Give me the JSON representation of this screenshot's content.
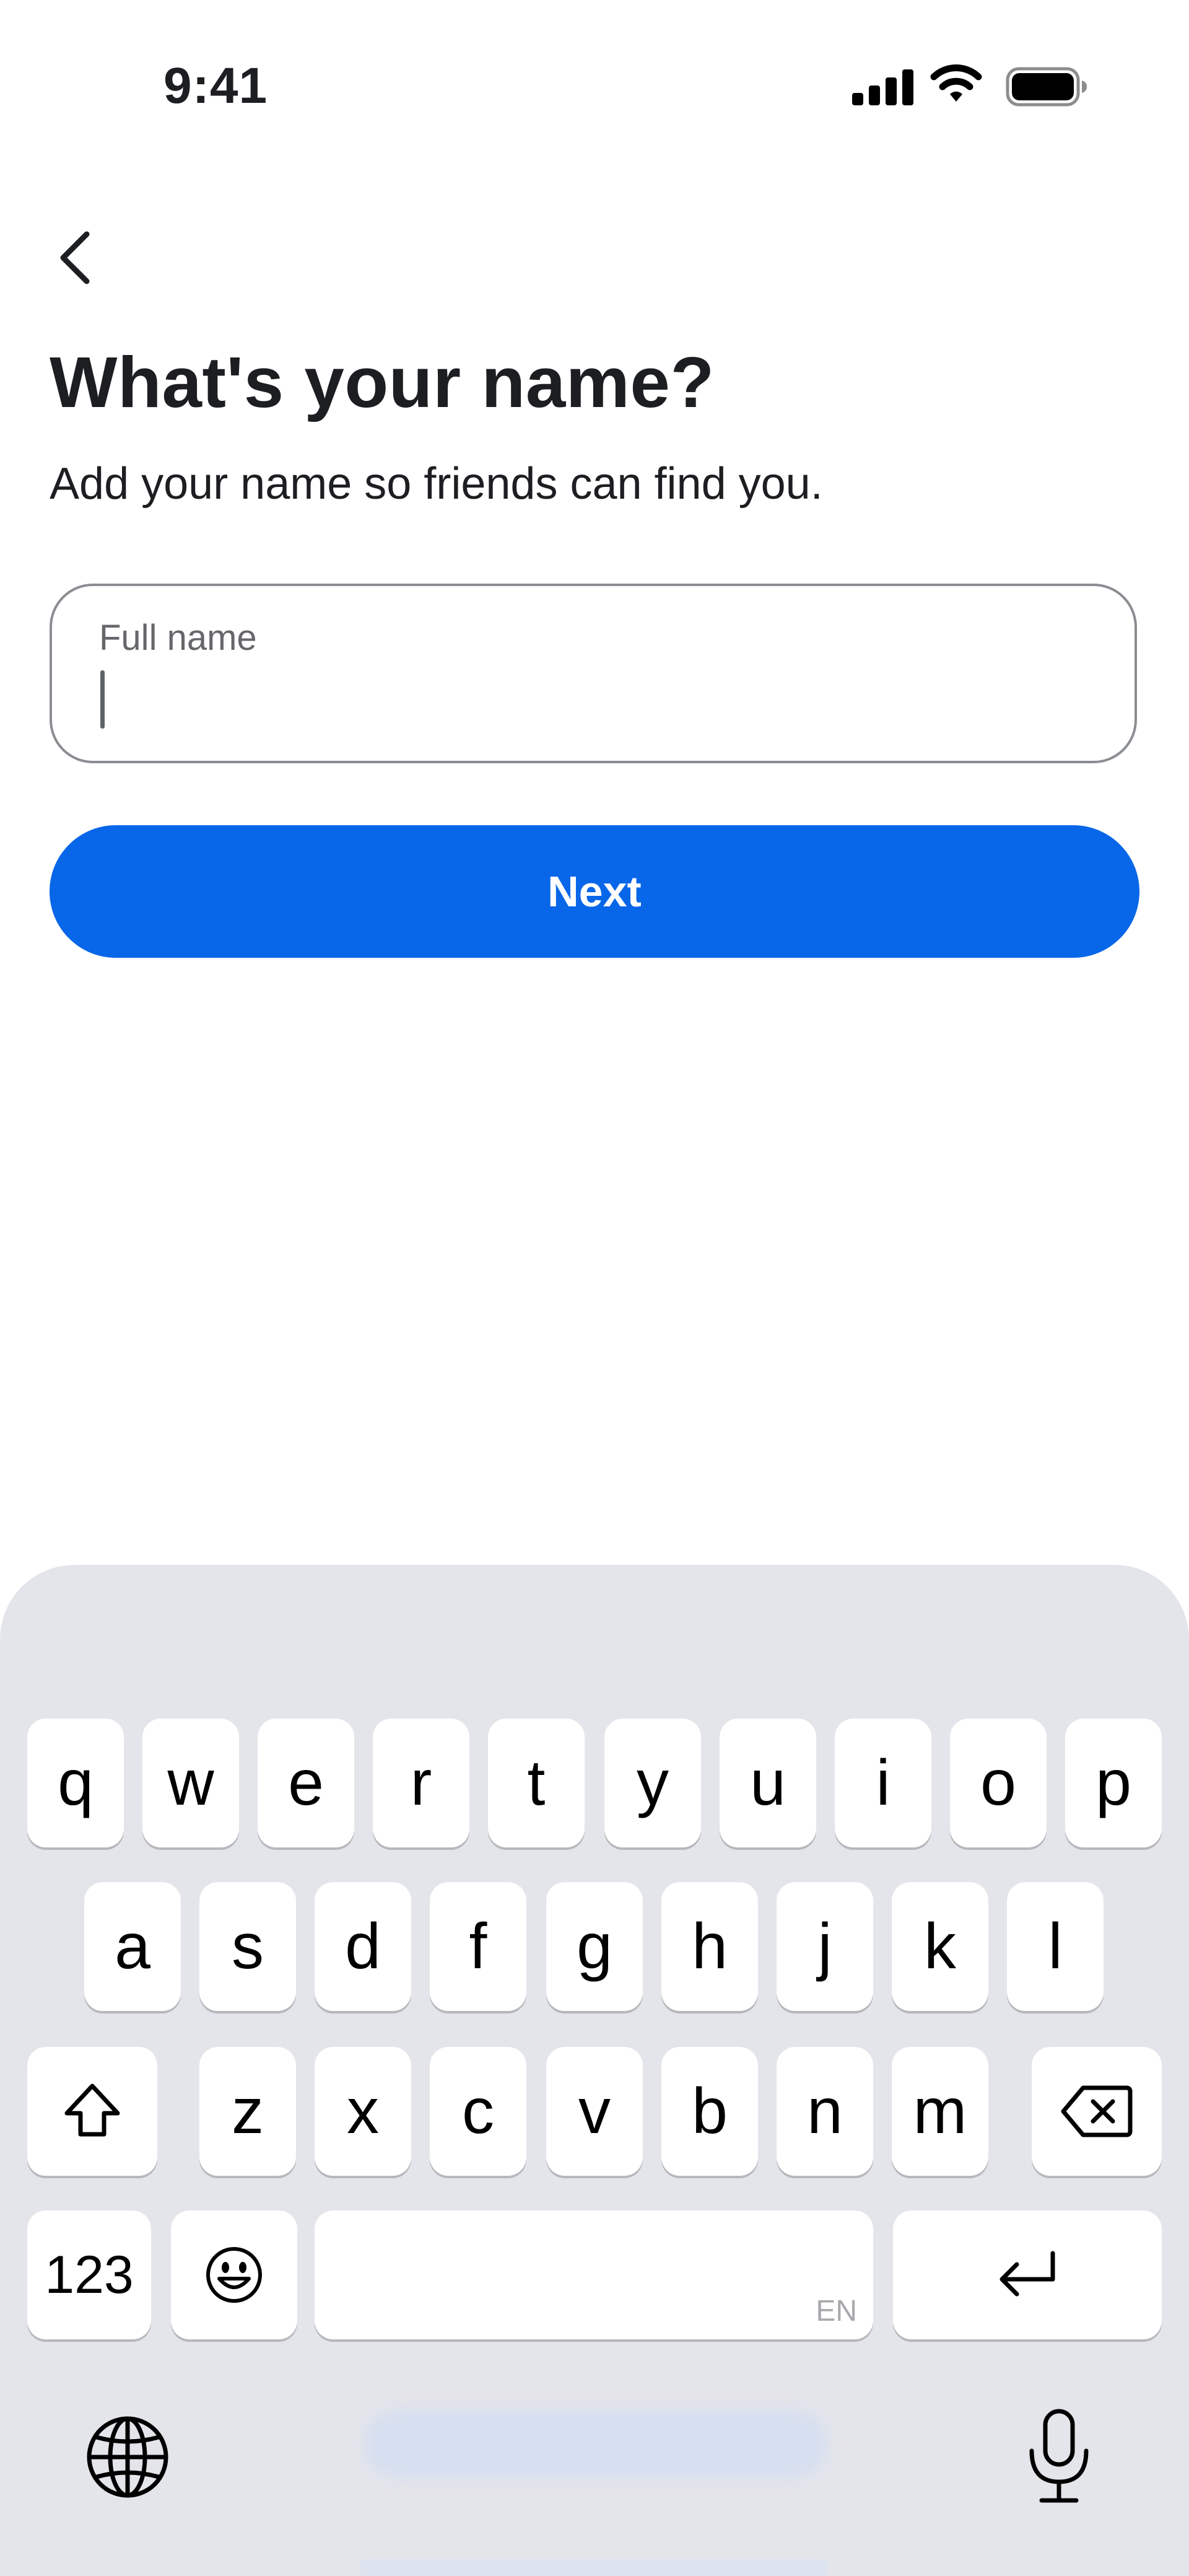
{
  "status_bar": {
    "time": "9:41",
    "signal_icon": "cellular-signal-icon",
    "wifi_icon": "wifi-icon",
    "battery_icon": "battery-icon"
  },
  "header": {
    "back_icon": "chevron-left-icon",
    "title": "What's your name?",
    "subtitle": "Add your name so friends can find you."
  },
  "form": {
    "full_name": {
      "label": "Full name",
      "value": ""
    },
    "next_label": "Next"
  },
  "colors": {
    "primary_button": "#0866e8",
    "keyboard_bg": "#e4e5ea"
  },
  "keyboard": {
    "row1": [
      "q",
      "w",
      "e",
      "r",
      "t",
      "y",
      "u",
      "i",
      "o",
      "p"
    ],
    "row2": [
      "a",
      "s",
      "d",
      "f",
      "g",
      "h",
      "j",
      "k",
      "l"
    ],
    "row3": [
      "z",
      "x",
      "c",
      "v",
      "b",
      "n",
      "m"
    ],
    "numbers_key": "123",
    "space_language": "EN",
    "shift_icon": "shift-icon",
    "delete_icon": "delete-backspace-icon",
    "emoji_icon": "emoji-icon",
    "return_icon": "return-icon",
    "globe_icon": "globe-icon",
    "mic_icon": "microphone-icon"
  }
}
